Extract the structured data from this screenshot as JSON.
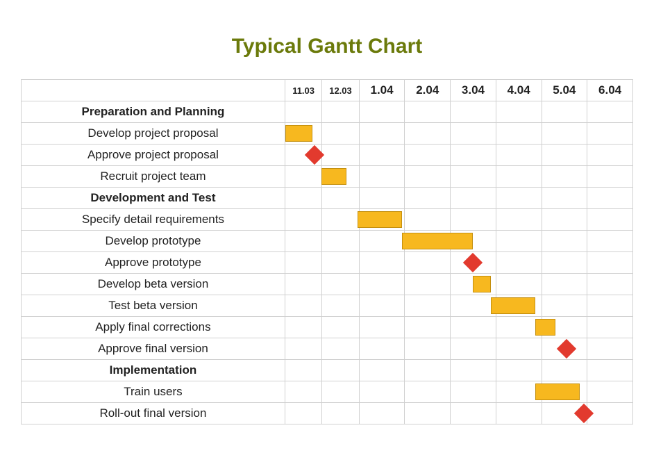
{
  "title": "Typical Gantt Chart",
  "timeline": [
    {
      "id": "t0",
      "label": "11.03",
      "small": true
    },
    {
      "id": "t1",
      "label": "12.03",
      "small": true
    },
    {
      "id": "t2",
      "label": "1.04",
      "small": false
    },
    {
      "id": "t3",
      "label": "2.04",
      "small": false
    },
    {
      "id": "t4",
      "label": "3.04",
      "small": false
    },
    {
      "id": "t5",
      "label": "4.04",
      "small": false
    },
    {
      "id": "t6",
      "label": "5.04",
      "small": false
    },
    {
      "id": "t7",
      "label": "6.04",
      "small": false
    }
  ],
  "rows": [
    {
      "label": "Preparation and Planning",
      "phase": true
    },
    {
      "label": "Develop project proposal",
      "phase": false,
      "bar": {
        "start": 0.0,
        "end": 0.75
      }
    },
    {
      "label": "Approve project proposal",
      "phase": false,
      "milestone": {
        "at": 0.8
      }
    },
    {
      "label": "Recruit project team",
      "phase": false,
      "bar": {
        "start": 1.0,
        "end": 1.7
      }
    },
    {
      "label": "Development and Test",
      "phase": true
    },
    {
      "label": "Specify detail requirements",
      "phase": false,
      "bar": {
        "start": 2.0,
        "end": 3.0
      }
    },
    {
      "label": "Develop prototype",
      "phase": false,
      "bar": {
        "start": 3.0,
        "end": 4.6
      }
    },
    {
      "label": "Approve prototype",
      "phase": false,
      "milestone": {
        "at": 4.6
      }
    },
    {
      "label": "Develop beta version",
      "phase": false,
      "bar": {
        "start": 4.6,
        "end": 5.0
      }
    },
    {
      "label": "Test beta version",
      "phase": false,
      "bar": {
        "start": 5.0,
        "end": 6.0
      }
    },
    {
      "label": "Apply final corrections",
      "phase": false,
      "bar": {
        "start": 6.0,
        "end": 6.45
      }
    },
    {
      "label": "Approve final version",
      "phase": false,
      "milestone": {
        "at": 6.7
      }
    },
    {
      "label": "Implementation",
      "phase": true
    },
    {
      "label": "Train users",
      "phase": false,
      "bar": {
        "start": 6.0,
        "end": 7.0
      }
    },
    {
      "label": "Roll-out final version",
      "phase": false,
      "milestone": {
        "at": 7.1
      }
    }
  ],
  "chart_data": {
    "type": "gantt",
    "title": "Typical Gantt Chart",
    "time_axis": [
      "11.03",
      "12.03",
      "1.04",
      "2.04",
      "3.04",
      "4.04",
      "5.04",
      "6.04"
    ],
    "phases": [
      {
        "name": "Preparation and Planning",
        "tasks": [
          {
            "name": "Develop project proposal",
            "type": "bar",
            "start": "11.03",
            "end_approx": "mid-11.03 to late-11.03"
          },
          {
            "name": "Approve project proposal",
            "type": "milestone",
            "at_approx": "~12.03 start"
          },
          {
            "name": "Recruit project team",
            "type": "bar",
            "start": "12.03",
            "end_approx": "mid-12.03"
          }
        ]
      },
      {
        "name": "Development and Test",
        "tasks": [
          {
            "name": "Specify detail requirements",
            "type": "bar",
            "start": "1.04",
            "end": "2.04"
          },
          {
            "name": "Develop prototype",
            "type": "bar",
            "start": "2.04",
            "end_approx": "mid-3.04"
          },
          {
            "name": "Approve prototype",
            "type": "milestone",
            "at_approx": "mid-3.04"
          },
          {
            "name": "Develop beta version",
            "type": "bar",
            "start_approx": "mid-3.04",
            "end": "4.04"
          },
          {
            "name": "Test beta version",
            "type": "bar",
            "start": "4.04",
            "end": "5.04"
          },
          {
            "name": "Apply final corrections",
            "type": "bar",
            "start": "5.04",
            "end_approx": "early-5.04 to mid-5.04"
          },
          {
            "name": "Approve final version",
            "type": "milestone",
            "at_approx": "late-5.04"
          }
        ]
      },
      {
        "name": "Implementation",
        "tasks": [
          {
            "name": "Train users",
            "type": "bar",
            "start": "5.04",
            "end": "6.04"
          },
          {
            "name": "Roll-out final version",
            "type": "milestone",
            "at_approx": "early-6.04"
          }
        ]
      }
    ]
  }
}
